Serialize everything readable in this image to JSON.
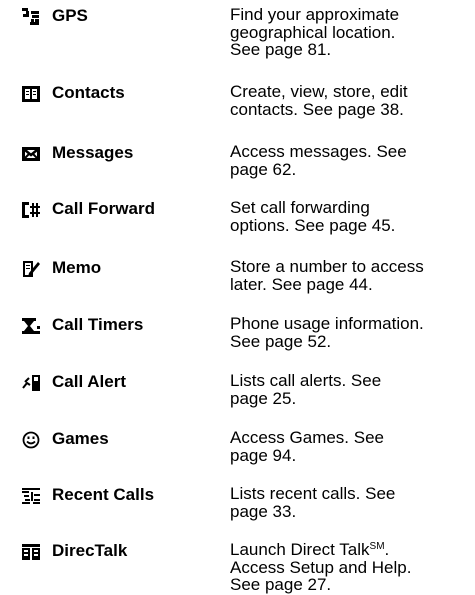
{
  "items": [
    {
      "id": "gps",
      "icon": "gps-icon",
      "name": "GPS",
      "lines": [
        "Find your approximate",
        "geographical location.",
        "See page 81."
      ]
    },
    {
      "id": "contacts",
      "icon": "contacts-book-icon",
      "name": "Contacts",
      "lines": [
        "Create, view, store, edit",
        "contacts. See page 38."
      ]
    },
    {
      "id": "messages",
      "icon": "envelope-icon",
      "name": "Messages",
      "lines": [
        "Access messages. See",
        "page 62."
      ]
    },
    {
      "id": "call-forward",
      "icon": "call-forward-icon",
      "name": "Call Forward",
      "lines": [
        "Set call forwarding",
        "options. See page 45."
      ]
    },
    {
      "id": "memo",
      "icon": "memo-pencil-icon",
      "name": "Memo",
      "lines": [
        "Store a number to access",
        "later. See page 44."
      ]
    },
    {
      "id": "call-timers",
      "icon": "hourglass-icon",
      "name": "Call Timers",
      "lines": [
        "Phone usage information.",
        "See page 52."
      ]
    },
    {
      "id": "call-alert",
      "icon": "call-alert-icon",
      "name": "Call Alert",
      "lines": [
        "Lists call alerts. See",
        "page 25."
      ]
    },
    {
      "id": "games",
      "icon": "smiley-face-icon",
      "name": "Games",
      "lines": [
        "Access Games. See",
        "page 94."
      ]
    },
    {
      "id": "recent-calls",
      "icon": "recent-calls-icon",
      "name": "Recent Calls",
      "lines": [
        "Lists recent calls. See",
        "page 33."
      ]
    },
    {
      "id": "directalk",
      "icon": "directalk-icon",
      "name": "DirecTalk",
      "lines": [
        "Launch Direct Talk",
        "Access  Setup and Help.",
        "See page 27."
      ],
      "line1_sup": "SM",
      "line1_tail": "."
    }
  ]
}
